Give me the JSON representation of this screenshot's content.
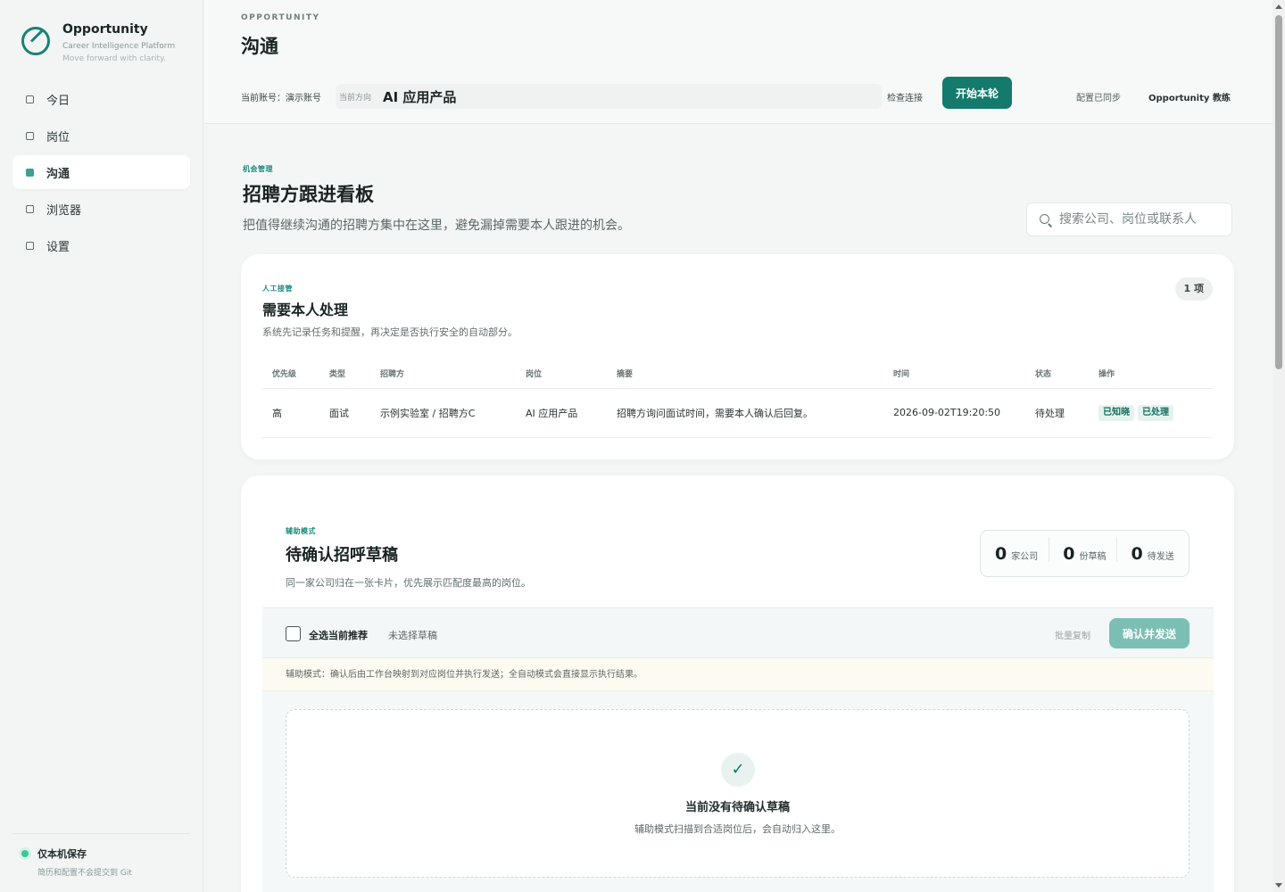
{
  "sidebar": {
    "brand_name": "Opportunity",
    "brand_subtitle": "Career Intelligence Platform",
    "brand_tagline": "Move forward with clarity.",
    "nav": [
      {
        "label": "今日",
        "active": false
      },
      {
        "label": "岗位",
        "active": false
      },
      {
        "label": "沟通",
        "active": true
      },
      {
        "label": "浏览器",
        "active": false
      },
      {
        "label": "设置",
        "active": false
      }
    ],
    "footer_title": "仅本机保存",
    "footer_subtitle": "简历和配置不会提交到 Git"
  },
  "header": {
    "eyebrow": "OPPORTUNITY",
    "title": "沟通",
    "account": "当前账号：演示账号",
    "direction_label": "当前方向",
    "direction_value": "AI 应用产品",
    "check_connection": "检查连接",
    "start_button": "开始本轮",
    "sync_status": "配置已同步",
    "coach": "Opportunity 教练"
  },
  "board": {
    "kicker": "机会管理",
    "title": "招聘方跟进看板",
    "description": "把值得继续沟通的招聘方集中在这里，避免漏掉需要本人跟进的机会。",
    "search_placeholder": "搜索公司、岗位或联系人"
  },
  "manual": {
    "kicker": "人工接管",
    "title": "需要本人处理",
    "description": "系统先记录任务和提醒，再决定是否执行安全的自动部分。",
    "count": "1 项",
    "columns": [
      "优先级",
      "类型",
      "招聘方",
      "岗位",
      "摘要",
      "时间",
      "状态",
      "操作"
    ],
    "rows": [
      {
        "priority": "高",
        "type": "面试",
        "recruiter": "示例实验室 / 招聘方C",
        "position": "AI 应用产品",
        "summary": "招聘方询问面试时间，需要本人确认后回复。",
        "time": "2026-09-02T19:20:50",
        "status": "待处理",
        "action_ack": "已知晓",
        "action_done": "已处理"
      }
    ]
  },
  "drafts": {
    "kicker": "辅助模式",
    "title": "待确认招呼草稿",
    "description": "同一家公司归在一张卡片，优先展示匹配度最高的岗位。",
    "stats": [
      {
        "value": "0",
        "label": "家公司"
      },
      {
        "value": "0",
        "label": "份草稿"
      },
      {
        "value": "0",
        "label": "待发送"
      }
    ],
    "select_all": "全选当前推荐",
    "no_selection": "未选择草稿",
    "batch_copy": "批量复制",
    "confirm_send": "确认并发送",
    "notice": "辅助模式：确认后由工作台映射到对应岗位并执行发送；全自动模式会直接显示执行结果。",
    "empty_icon": "✓",
    "empty_title": "当前没有待确认草稿",
    "empty_desc": "辅助模式扫描到合适岗位后，会自动归入这里。"
  },
  "colors": {
    "accent": "#137a6c",
    "accent_light": "#7bbfb4",
    "status_green": "#3cc79a"
  }
}
